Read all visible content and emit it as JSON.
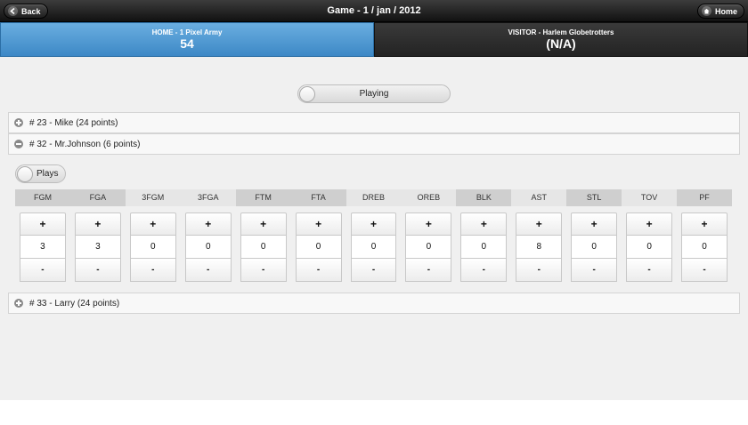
{
  "header": {
    "title": "Game - 1 / jan / 2012",
    "back_label": "Back",
    "home_label": "Home",
    "back_icon": "arrow-left-icon",
    "home_icon": "house-icon"
  },
  "teams": {
    "home": {
      "label": "HOME - 1 Pixel Army",
      "score": "54"
    },
    "visitor": {
      "label": "VISITOR - Harlem Globetrotters",
      "score": "(N/A)"
    }
  },
  "toggles": {
    "playing_label": "Playing",
    "plays_label": "Plays"
  },
  "players": [
    {
      "label": "# 23 - Mike (24 points)",
      "expanded": false
    },
    {
      "label": "# 32 - Mr.Johnson (6 points)",
      "expanded": true
    },
    {
      "label": "# 33 - Larry (24 points)",
      "expanded": false
    }
  ],
  "stats": {
    "columns": [
      {
        "name": "FGM",
        "value": "3"
      },
      {
        "name": "FGA",
        "value": "3"
      },
      {
        "name": "3FGM",
        "value": "0"
      },
      {
        "name": "3FGA",
        "value": "0"
      },
      {
        "name": "FTM",
        "value": "0"
      },
      {
        "name": "FTA",
        "value": "0"
      },
      {
        "name": "DREB",
        "value": "0"
      },
      {
        "name": "OREB",
        "value": "0"
      },
      {
        "name": "BLK",
        "value": "0"
      },
      {
        "name": "AST",
        "value": "8"
      },
      {
        "name": "STL",
        "value": "0"
      },
      {
        "name": "TOV",
        "value": "0"
      },
      {
        "name": "PF",
        "value": "0"
      }
    ],
    "plus_label": "+",
    "minus_label": "-"
  },
  "colors": {
    "home_accent": "#4a90d0",
    "visitor_bg": "#2a2a2a",
    "header_bg": "#222222"
  }
}
